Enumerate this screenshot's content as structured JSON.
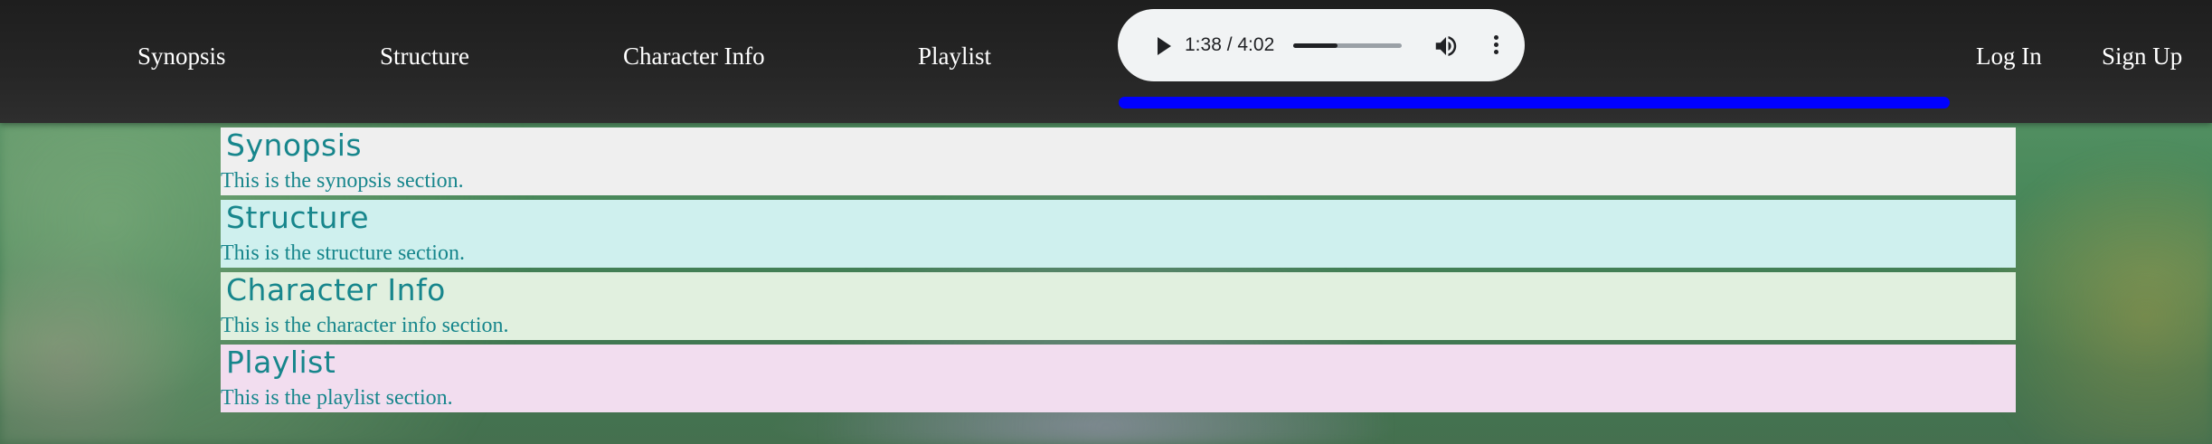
{
  "nav": {
    "links": [
      "Synopsis",
      "Structure",
      "Character Info",
      "Playlist"
    ],
    "login": "Log In",
    "signup": "Sign Up"
  },
  "audio": {
    "time": "1:38 / 4:02",
    "progress": 0.405,
    "play_icon": "play-icon",
    "volume_icon": "volume-icon",
    "more_icon": "more-vert-icon"
  },
  "custom_progress": {
    "color": "#0000ff"
  },
  "sections": [
    {
      "title": "Synopsis",
      "text": "This is the synopsis section.",
      "bg": "#efefef"
    },
    {
      "title": "Structure",
      "text": "This is the structure section.",
      "bg": "#cff0ee"
    },
    {
      "title": "Character Info",
      "text": "This is the character info section.",
      "bg": "#e1f0df"
    },
    {
      "title": "Playlist",
      "text": "This is the playlist section.",
      "bg": "#f2ddef"
    }
  ],
  "colors": {
    "heading": "#17868c",
    "navbar": "#222222"
  }
}
